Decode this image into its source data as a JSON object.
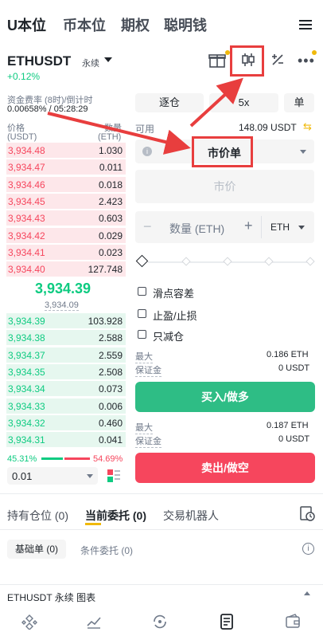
{
  "top_tabs": [
    "U本位",
    "币本位",
    "期权",
    "聪明钱"
  ],
  "pair": {
    "symbol": "ETHUSDT",
    "type": "永续",
    "change": "+0.12%"
  },
  "funding": {
    "label": "资金费率 (8时)/倒计时",
    "value": "0.00658% / 05:28:29"
  },
  "orderbook": {
    "price_header": "价格",
    "price_unit": "(USDT)",
    "qty_header": "数量",
    "qty_unit": "(ETH)",
    "asks": [
      {
        "price": "3,934.48",
        "qty": "1.030",
        "depth": 0.1
      },
      {
        "price": "3,934.47",
        "qty": "0.011",
        "depth": 0.05
      },
      {
        "price": "3,934.46",
        "qty": "0.018",
        "depth": 0.05
      },
      {
        "price": "3,934.45",
        "qty": "2.423",
        "depth": 0.12
      },
      {
        "price": "3,934.43",
        "qty": "0.603",
        "depth": 0.08
      },
      {
        "price": "3,934.42",
        "qty": "0.029",
        "depth": 0.05
      },
      {
        "price": "3,934.41",
        "qty": "0.023",
        "depth": 0.05
      },
      {
        "price": "3,934.40",
        "qty": "127.748",
        "depth": 1.0
      }
    ],
    "last_price": "3,934.39",
    "mark_price": "3,934.09",
    "bids": [
      {
        "price": "3,934.39",
        "qty": "103.928",
        "depth": 1.0
      },
      {
        "price": "3,934.38",
        "qty": "2.588",
        "depth": 0.3
      },
      {
        "price": "3,934.37",
        "qty": "2.559",
        "depth": 0.3
      },
      {
        "price": "3,934.35",
        "qty": "2.508",
        "depth": 0.3
      },
      {
        "price": "3,934.34",
        "qty": "0.073",
        "depth": 0.3
      },
      {
        "price": "3,934.33",
        "qty": "0.006",
        "depth": 0.3
      },
      {
        "price": "3,934.32",
        "qty": "0.460",
        "depth": 0.3
      },
      {
        "price": "3,934.31",
        "qty": "0.041",
        "depth": 0.3
      }
    ],
    "buy_ratio": "45.31%",
    "sell_ratio": "54.69%",
    "precision": "0.01"
  },
  "order_form": {
    "margin_mode": "逐仓",
    "leverage": "5x",
    "position_mode": "单",
    "available_label": "可用",
    "available_value": "148.09 USDT",
    "order_type": "市价单",
    "price_placeholder": "市价",
    "qty_placeholder": "数量 (ETH)",
    "qty_unit": "ETH",
    "slippage_label": "滑点容差",
    "tpsl_label": "止盈/止损",
    "reduce_only_label": "只减仓",
    "buy": {
      "max_label": "最大",
      "max_value": "0.186 ETH",
      "margin_label": "保证金",
      "margin_value": "0 USDT",
      "button": "买入/做多"
    },
    "sell": {
      "max_label": "最大",
      "max_value": "0.187 ETH",
      "margin_label": "保证金",
      "margin_value": "0 USDT",
      "button": "卖出/做空"
    }
  },
  "bottom_tabs": [
    "持有仓位 (0)",
    "当前委托 (0)",
    "交易机器人"
  ],
  "sub_tabs": [
    "基础单 (0)",
    "条件委托 (0)"
  ],
  "chart_bar": "ETHUSDT 永续 图表",
  "colors": {
    "green": "#0ecb81",
    "red": "#f6465d",
    "annotation": "#e83e3e"
  }
}
